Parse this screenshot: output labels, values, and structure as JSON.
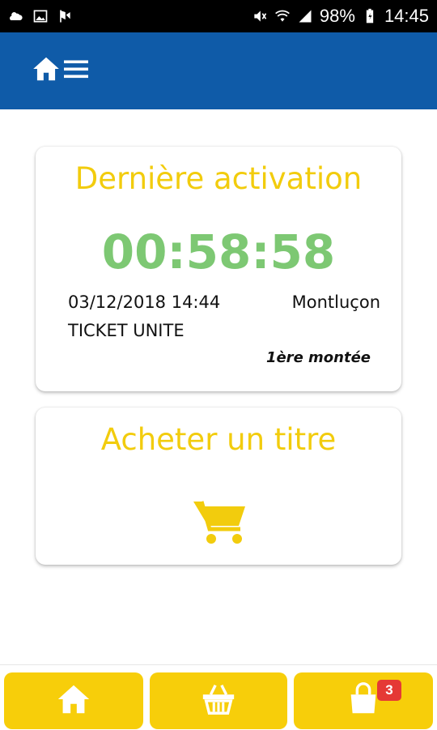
{
  "status_bar": {
    "icons_left": [
      "weather-icon",
      "image-icon",
      "flag-icon"
    ],
    "icons_right": [
      "mute-icon",
      "wifi-icon",
      "signal-icon"
    ],
    "battery": "98%",
    "time": "14:45"
  },
  "app_bar": {
    "home_icon": "home-icon",
    "menu_icon": "hamburger-menu-icon"
  },
  "last_activation": {
    "title": "Dernière activation",
    "timer": "00:58:58",
    "date": "03/12/2018 14:44",
    "city": "Montluçon",
    "ticket_type": "TICKET UNITE",
    "boarding": "1ère montée"
  },
  "buy_ticket": {
    "title": "Acheter un titre",
    "icon": "cart-icon"
  },
  "bottom_nav": {
    "items": [
      {
        "icon": "home-icon"
      },
      {
        "icon": "basket-icon"
      },
      {
        "icon": "shopping-bag-icon",
        "badge": "3"
      }
    ]
  },
  "colors": {
    "app_bar": "#0f5ba8",
    "accent_yellow": "#f2cc0d",
    "button_yellow": "#f7ce0a",
    "timer_green": "#7dc873",
    "badge_red": "#e53935"
  }
}
